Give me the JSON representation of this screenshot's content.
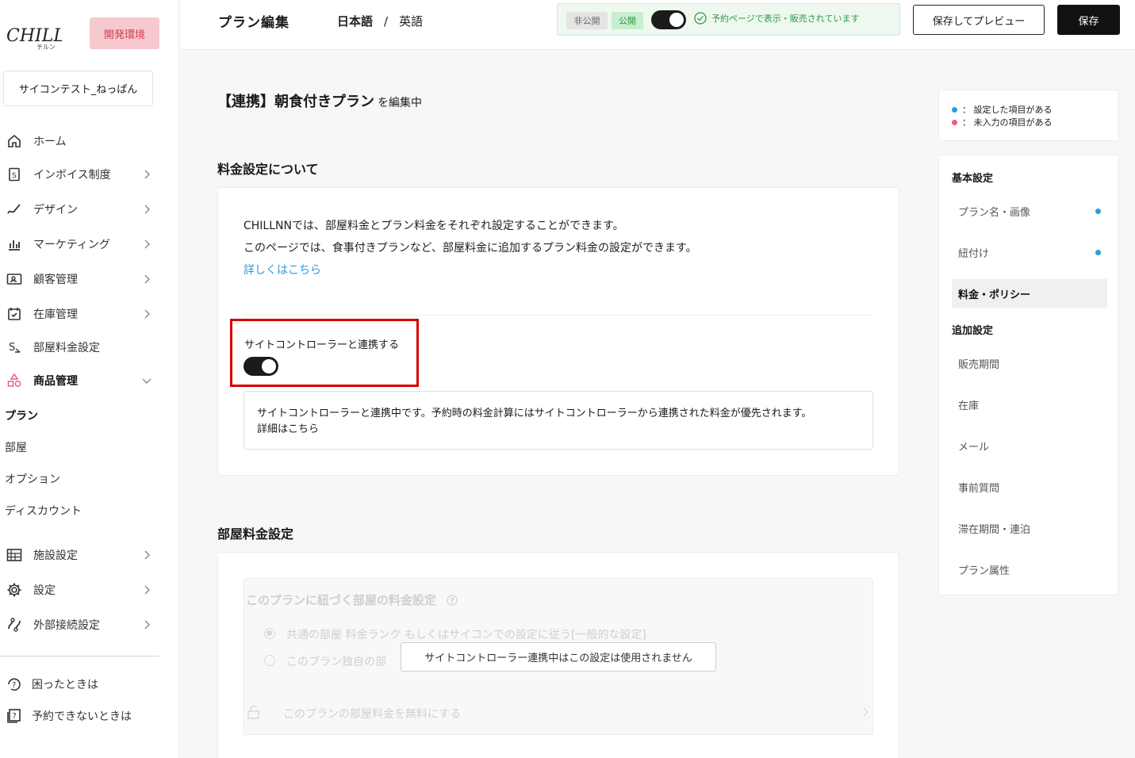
{
  "colors": {
    "accent_blue": "#2d9cdb",
    "warning_pink": "#e9627a",
    "success_green": "#2f9a45",
    "highlight_red": "#d40000"
  },
  "sidebar": {
    "env_badge": "開発環境",
    "account": "サイコンテスト_ねっぱん",
    "items": [
      {
        "label": "ホーム",
        "icon": "home-icon"
      },
      {
        "label": "インボイス制度",
        "icon": "invoice-icon"
      },
      {
        "label": "デザイン",
        "icon": "design-icon"
      },
      {
        "label": "マーケティング",
        "icon": "chart-icon"
      },
      {
        "label": "顧客管理",
        "icon": "customer-icon"
      },
      {
        "label": "在庫管理",
        "icon": "calendar-icon"
      },
      {
        "label": "部屋料金設定",
        "icon": "yen-icon"
      },
      {
        "label": "商品管理",
        "icon": "shapes-icon"
      }
    ],
    "sub_items": [
      "プラン",
      "部屋",
      "オプション",
      "ディスカウント"
    ],
    "items2": [
      {
        "label": "施設設定",
        "icon": "building-icon"
      },
      {
        "label": "設定",
        "icon": "gear-icon"
      },
      {
        "label": "外部接続設定",
        "icon": "connect-icon"
      }
    ],
    "help": [
      {
        "label": "困ったときは",
        "icon": "help-icon"
      },
      {
        "label": "予約できないときは",
        "icon": "question-icon"
      }
    ]
  },
  "header": {
    "title": "プラン編集",
    "lang_ja": "日本語",
    "lang_sep": "/",
    "lang_en": "英語",
    "private": "非公開",
    "public": "公開",
    "status": "予約ページで表示・販売されています",
    "preview_button": "保存してプレビュー",
    "save_button": "保存"
  },
  "main": {
    "plan_name": "【連携】朝食付きプラン",
    "editing_suffix": "を編集中",
    "section1_title": "料金設定について",
    "desc_line1": "CHILLNNでは、部屋料金とプラン料金をそれぞれ設定することができます。",
    "desc_line2": "このページでは、食事付きプランなど、部屋料金に追加するプラン料金の設定ができます。",
    "desc_link": "詳しくはこちら",
    "sc_label": "サイトコントローラーと連携する",
    "info_line1": "サイトコントローラーと連携中です。予約時の料金計算にはサイトコントローラーから連携された料金が優先されます。",
    "info_line2": "詳細はこちら",
    "section2_title": "部屋料金設定",
    "disabled_title": "このプランに紐づく部屋の料金設定",
    "opt1": "共通の部屋 料金ランク もしくはサイコンでの設定に従う[一般的な設定]",
    "opt2": "このプラン独自の部",
    "free_toggle": "このプランの部屋料金を無料にする",
    "tooltip": "サイトコントローラー連携中はこの設定は使用されません"
  },
  "legend": {
    "set": "： 設定した項目がある",
    "missing": "： 未入力の項目がある"
  },
  "toc": {
    "basic_head": "基本設定",
    "basic_items": [
      "プラン名・画像",
      "紐付け",
      "料金・ポリシー"
    ],
    "extra_head": "追加設定",
    "extra_items": [
      "販売期間",
      "在庫",
      "メール",
      "事前質問",
      "滞在期間・連泊",
      "プラン属性"
    ]
  }
}
